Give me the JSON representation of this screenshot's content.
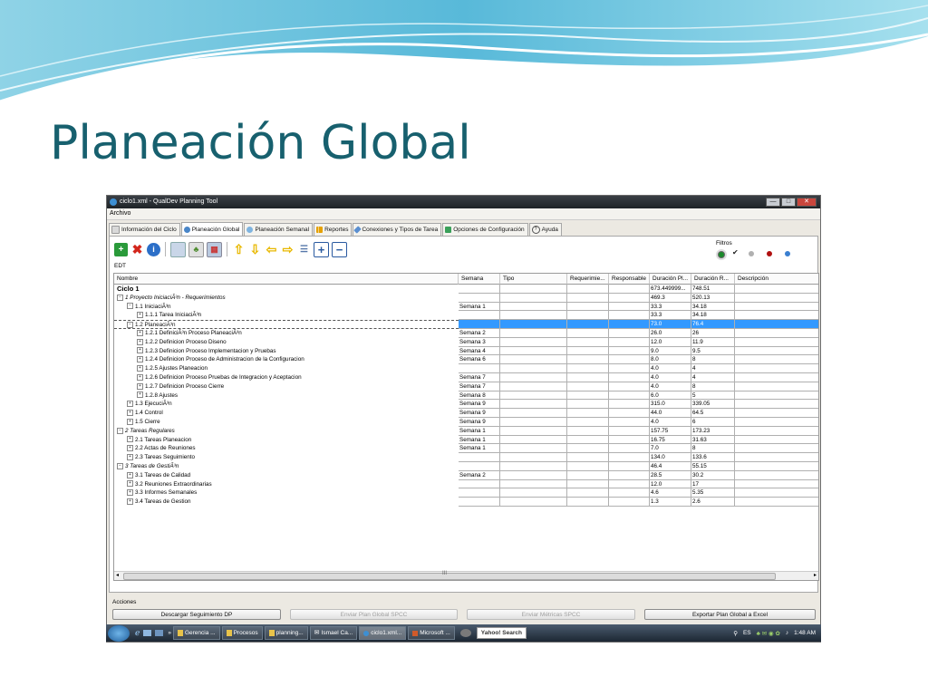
{
  "slide": {
    "title": "Planeación Global"
  },
  "window": {
    "title": "ciclo1.xml - QualDev Planning Tool",
    "menu": "Archivo",
    "buttons": {
      "minimize": "—",
      "maximize": "□",
      "close": "✕"
    }
  },
  "tabs": [
    {
      "label": "Información del Ciclo"
    },
    {
      "label": "Planeación Global"
    },
    {
      "label": "Planeación Semanal"
    },
    {
      "label": "Reportes"
    },
    {
      "label": "Conexiones y  Tipos de Tarea"
    },
    {
      "label": "Opciones de Configuración"
    },
    {
      "label": "Ayuda"
    }
  ],
  "filters": {
    "label": "Filtros",
    "colors": [
      "#1a8a2a",
      "#222222",
      "#b0b0b0",
      "#b01010",
      "#3a7fd0"
    ]
  },
  "edt_label": "EDT",
  "columns": [
    "Nombre",
    "Semana",
    "Tipo",
    "Requerimie...",
    "Responsable",
    "Duración Pl...",
    "Duración R...",
    "Descripción"
  ],
  "rows": [
    {
      "name": "Ciclo 1",
      "semana": "",
      "planned": "673.449999...",
      "real": "748.51"
    },
    {
      "name": "1 Proyecto IniciaciÃ³n - Requerimientos",
      "semana": "",
      "planned": "469.3",
      "real": "520.13"
    },
    {
      "name": "1.1 IniciaciÃ³n",
      "semana": "Semana 1",
      "planned": "33.3",
      "real": "34.18"
    },
    {
      "name": "1.1.1 Tarea IniciaciÃ³n",
      "semana": "",
      "planned": "33.3",
      "real": "34.18"
    },
    {
      "name": "1.2 PlaneaciÃ³n",
      "semana": "",
      "planned": "73.0",
      "real": "76.4"
    },
    {
      "name": "1.2.1 DefiniciÃ³n Proceso PlaneaciÃ³n",
      "semana": "Semana 2",
      "planned": "26.0",
      "real": "26"
    },
    {
      "name": "1.2.2 Definicion Proceso Diseno",
      "semana": "Semana 3",
      "planned": "12.0",
      "real": "11.9"
    },
    {
      "name": "1.2.3 Definicion Proceso Implementacion y Pruebas",
      "semana": "Semana 4",
      "planned": "9.0",
      "real": "9.5"
    },
    {
      "name": "1.2.4 Definicion Proceso de Administracion de la Configuracion",
      "semana": "Semana 6",
      "planned": "8.0",
      "real": "8"
    },
    {
      "name": "1.2.5 Ajustes Planeacion",
      "semana": "",
      "planned": "4.0",
      "real": "4"
    },
    {
      "name": "1.2.6 Definicion Proceso Pruebas de Integracion y Aceptacion",
      "semana": "Semana 7",
      "planned": "4.0",
      "real": "4"
    },
    {
      "name": "1.2.7 Definicion Proceso Cierre",
      "semana": "Semana 7",
      "planned": "4.0",
      "real": "8"
    },
    {
      "name": "1.2.8 Ajustes",
      "semana": "Semana 8",
      "planned": "6.0",
      "real": "5"
    },
    {
      "name": "1.3 EjecuciÃ³n",
      "semana": "Semana 9",
      "planned": "315.0",
      "real": "339.05"
    },
    {
      "name": "1.4 Control",
      "semana": "Semana 9",
      "planned": "44.0",
      "real": "64.5"
    },
    {
      "name": "1.5 Cierre",
      "semana": "Semana 9",
      "planned": "4.0",
      "real": "6"
    },
    {
      "name": "2 Tareas Regulares",
      "semana": "Semana 1",
      "planned": "157.75",
      "real": "173.23"
    },
    {
      "name": "2.1 Tareas Planeacion",
      "semana": "Semana 1",
      "planned": "16.75",
      "real": "31.63"
    },
    {
      "name": "2.2 Actas de Reuniones",
      "semana": "Semana 1",
      "planned": "7.0",
      "real": "8"
    },
    {
      "name": "2.3 Tareas Seguimiento",
      "semana": "",
      "planned": "134.0",
      "real": "133.6"
    },
    {
      "name": "3 Tareas de GestiÃ³n",
      "semana": "",
      "planned": "46.4",
      "real": "55.15"
    },
    {
      "name": "3.1 Tareas de Calidad",
      "semana": "Semana 2",
      "planned": "28.5",
      "real": "30.2"
    },
    {
      "name": "3.2 Reuniones Extraordinarias",
      "semana": "",
      "planned": "12.0",
      "real": "17"
    },
    {
      "name": "3.3 Informes Semanales",
      "semana": "",
      "planned": "4.6",
      "real": "5.35"
    },
    {
      "name": "3.4 Tareas de Gestion",
      "semana": "",
      "planned": "1.3",
      "real": "2.6"
    }
  ],
  "scroll_grip": "III",
  "actions": {
    "label": "Acciones",
    "buttons": [
      {
        "label": "Descargar Seguimiento DP",
        "enabled": true
      },
      {
        "label": "Enviar Plan Global SPCC",
        "enabled": false
      },
      {
        "label": "Enviar Métricas SPCC",
        "enabled": false
      },
      {
        "label": "Exportar Plan Global a Excel",
        "enabled": true
      }
    ]
  },
  "taskbar": {
    "more": "»",
    "items": [
      "Gerencia ...",
      "Procesos",
      "planning...",
      "Ismael Ca...",
      "ciclo1.xml...",
      "Microsoft ..."
    ],
    "search": "Yahoo! Search",
    "lang": "ES",
    "time": "1:48 AM"
  }
}
